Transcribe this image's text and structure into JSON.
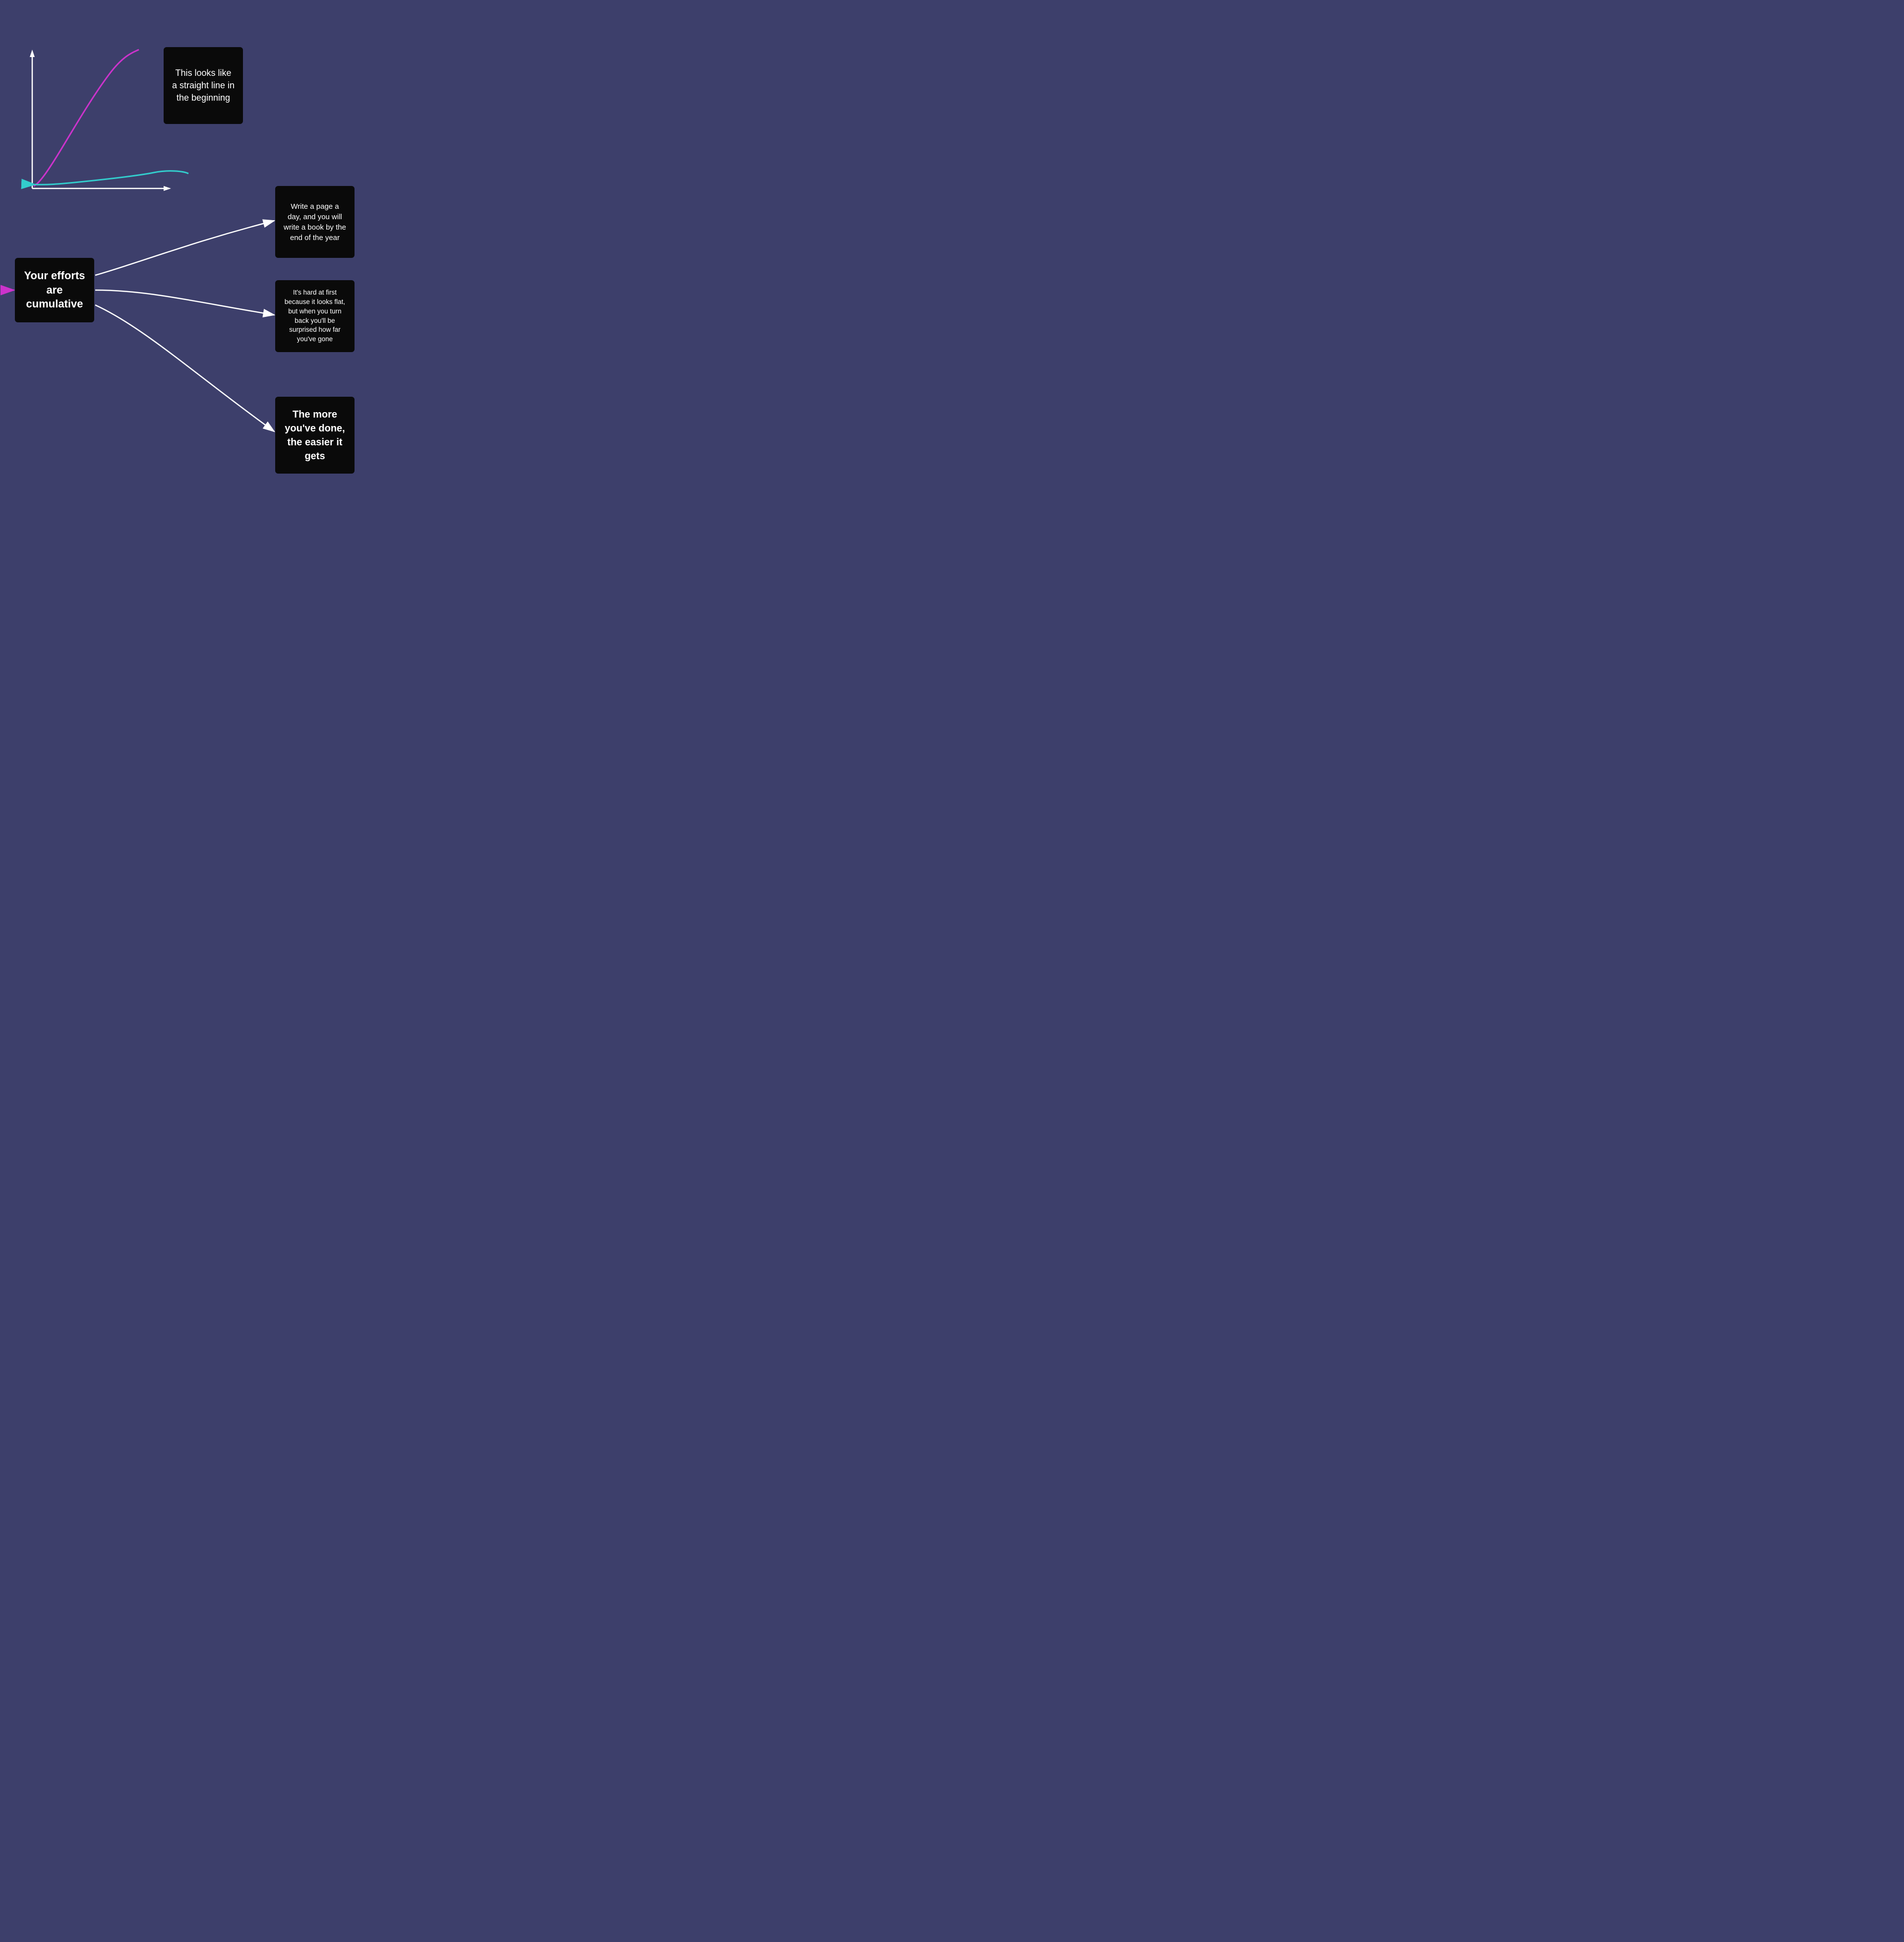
{
  "cards": {
    "straight_line": {
      "text": "This looks like a straight line in the beginning"
    },
    "efforts": {
      "text": "Your efforts are cumulative"
    },
    "write_page": {
      "text": "Write a page a day, and you will write a book by the end of the year"
    },
    "hard_first": {
      "text": "It's hard at first because it looks flat, but when you turn back you'll be surprised how far you've gone"
    },
    "more_done": {
      "text": "The more you've done, the easier it gets"
    }
  },
  "colors": {
    "background": "#3d3f6b",
    "card_bg": "#0a0a0a",
    "white": "#ffffff",
    "magenta": "#cc33cc",
    "teal": "#33cccc"
  }
}
